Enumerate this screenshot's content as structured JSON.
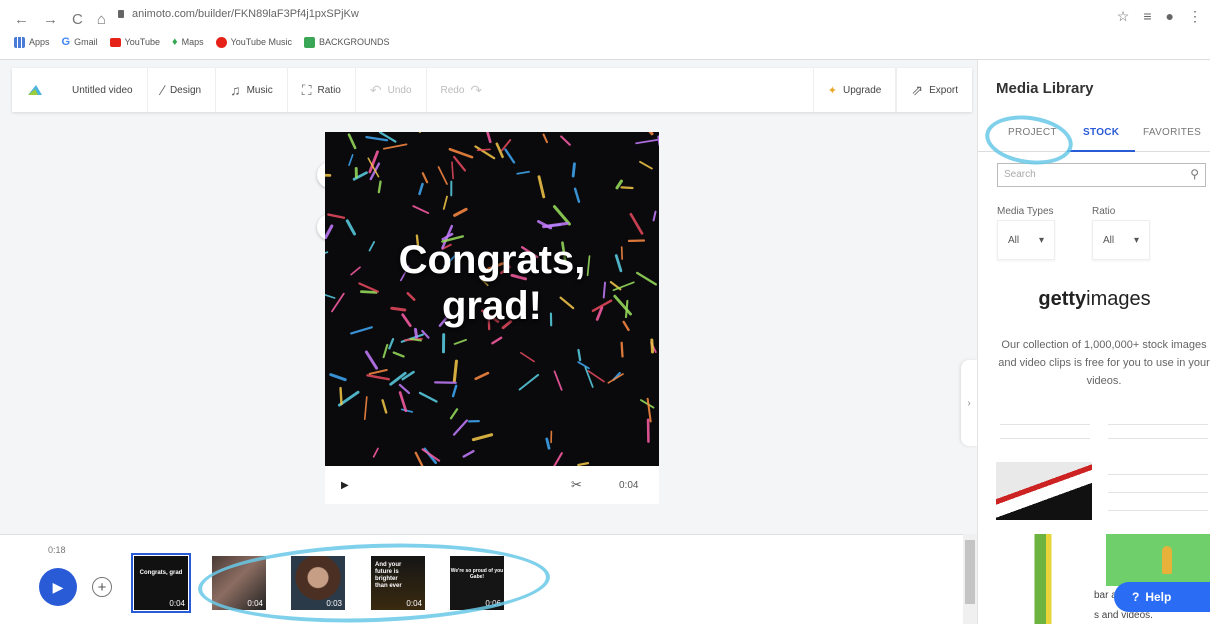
{
  "browser": {
    "url": "animoto.com/builder/FKN89laF3Pf4j1pxSPjKw",
    "bookmarks": [
      "Apps",
      "Gmail",
      "YouTube",
      "Maps",
      "YouTube Music",
      "BACKGROUNDS"
    ],
    "nav_icons": [
      "back-icon",
      "forward-icon",
      "reload-icon",
      "home-icon"
    ],
    "right_icons": [
      "star-icon",
      "playlist-icon",
      "account-icon",
      "menu-icon"
    ]
  },
  "toolbar": {
    "video_name": "Untitled video",
    "design": "Design",
    "music": "Music",
    "ratio": "Ratio",
    "undo": "Undo",
    "redo": "Redo",
    "upgrade": "Upgrade",
    "export": "Export"
  },
  "canvas": {
    "title_line1": "Congrats,",
    "title_line2": "grad!",
    "duration": "0:04"
  },
  "timeline": {
    "total": "0:18",
    "thumbs": [
      {
        "title": "Congrats, grad",
        "duration": "0:04",
        "selected": true
      },
      {
        "title": "",
        "duration": "0:04"
      },
      {
        "title": "",
        "duration": "0:03"
      },
      {
        "title": "And your future is brighter than ever",
        "duration": "0:04"
      },
      {
        "title": "We're so proud of you Gabe!",
        "duration": "0:06"
      }
    ]
  },
  "sidebar": {
    "title": "Media Library",
    "tabs": [
      "PROJECT",
      "STOCK",
      "FAVORITES"
    ],
    "active_tab": "STOCK",
    "search_placeholder": "Search",
    "media_types_label": "Media Types",
    "media_types_value": "All",
    "ratio_label": "Ratio",
    "ratio_value": "All",
    "getty_bold": "getty",
    "getty_light": "images",
    "getty_desc": "Our collection of 1,000,000+ stock images and video clips is free for you to use in your videos.",
    "partial_text_1": "bar above",
    "partial_text_2": "s and videos."
  },
  "help": "Help",
  "colors": {
    "accent": "#2a5bd7",
    "annotation": "#69c8e8"
  }
}
